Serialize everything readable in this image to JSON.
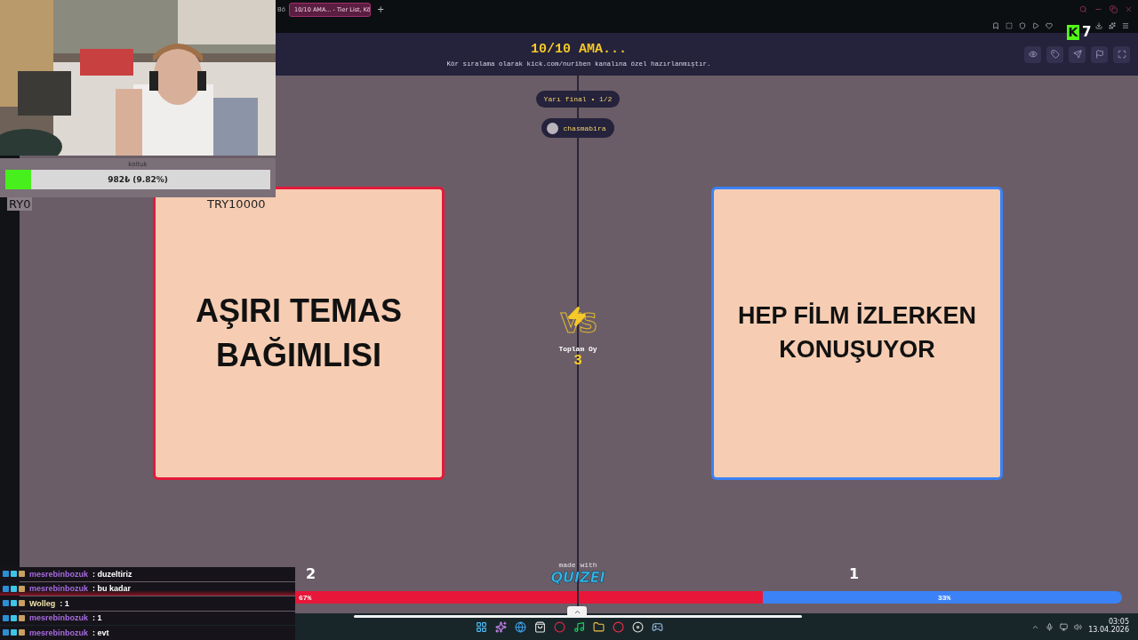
{
  "browser": {
    "cut_text": "Bö",
    "tab": {
      "title": "10/10 AMA... - Tier List, Kö",
      "selected": true
    },
    "new_tab": "+"
  },
  "kick_badge": {
    "logo": "K",
    "count": "7"
  },
  "header": {
    "title": "10/10 AMA...",
    "subtitle": "Kör sıralama olarak kick.com/nuriben kanalına özel hazırlanmıştır."
  },
  "round": {
    "label": "Yarı final • 1/2",
    "user": "chasmabira"
  },
  "cards": [
    {
      "text": "AŞIRI TEMAS BAĞIMLISI",
      "color": "#e3193a",
      "votes": "2"
    },
    {
      "text": "HEP FİLM İZLERKEN KONUŞUYOR",
      "color": "#3b82f6",
      "votes": "1"
    }
  ],
  "vs": "VS",
  "total": {
    "label": "Toplam Oy",
    "value": "3"
  },
  "branding": {
    "caption": "made with",
    "logo": "QUIZEI"
  },
  "vote_bar": {
    "level": 0.566,
    "left": {
      "label": "67%",
      "color": "#e8173a"
    },
    "right": {
      "label": "33%",
      "color": "#3b82f6"
    }
  },
  "goal": {
    "title": "koltuk",
    "amount": "982₺ (9.82%)",
    "level": 0.0982,
    "min": "RY0",
    "max": "TRY10000"
  },
  "chat": [
    {
      "user": "mesrebinbozuk",
      "message": ": duzeltiriz",
      "color": "#a66bdf",
      "highlighted": false
    },
    {
      "user": "mesrebinbozuk",
      "message": ": bu kadar",
      "color": "#a66bdf",
      "highlighted": true
    },
    {
      "user": "Wolleg",
      "message": ": 1",
      "color": "#efe2a8",
      "highlighted": false
    },
    {
      "user": "mesrebinbozuk",
      "message": ": 1",
      "color": "#a66bdf",
      "highlighted": false
    },
    {
      "user": "mesrebinbozuk",
      "message": ": evt",
      "color": "#a66bdf",
      "highlighted": false
    }
  ],
  "taskbar": {
    "time": "03:05",
    "date": "13.04.2026"
  }
}
